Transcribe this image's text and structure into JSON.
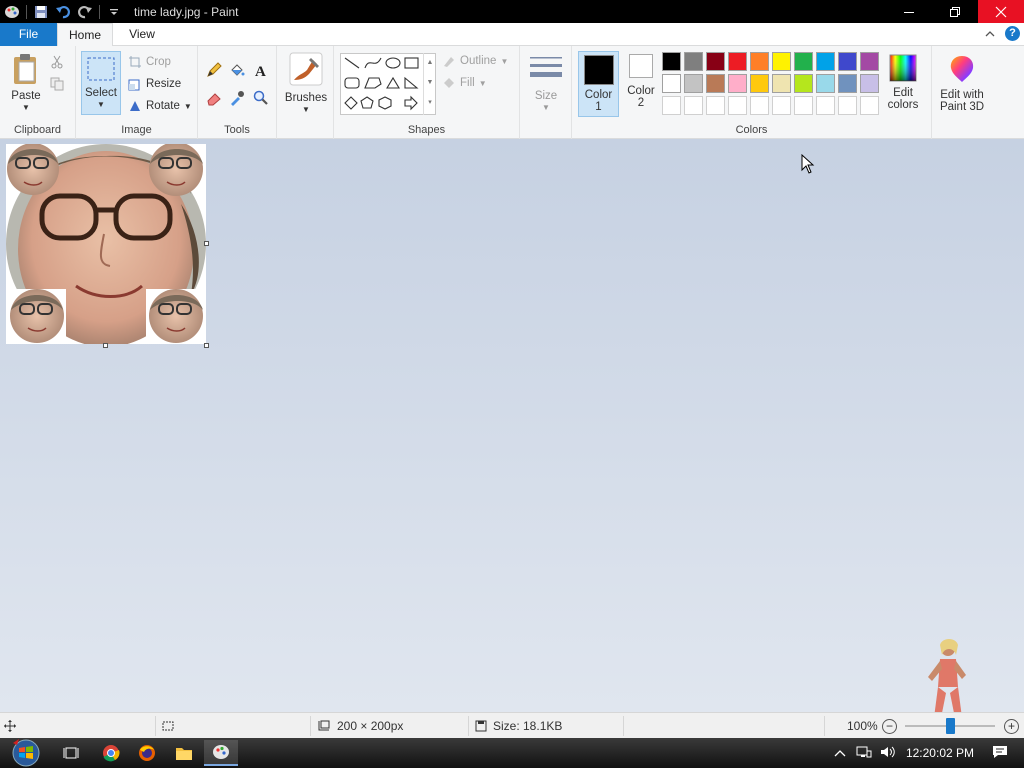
{
  "window": {
    "title": "time lady.jpg - Paint"
  },
  "tabs": {
    "file": "File",
    "home": "Home",
    "view": "View"
  },
  "ribbon": {
    "clipboard": {
      "label": "Clipboard",
      "paste": "Paste"
    },
    "image": {
      "label": "Image",
      "select": "Select",
      "crop": "Crop",
      "resize": "Resize",
      "rotate": "Rotate"
    },
    "tools": {
      "label": "Tools"
    },
    "brushes": {
      "label": "Brushes"
    },
    "shapes": {
      "label": "Shapes",
      "outline": "Outline",
      "fill": "Fill"
    },
    "size": {
      "label": "Size"
    },
    "colors": {
      "label": "Colors",
      "color1_line1": "Color",
      "color1_line2": "1",
      "color2_line1": "Color",
      "color2_line2": "2",
      "edit_line1": "Edit",
      "edit_line2": "colors",
      "paint3d_line1": "Edit with",
      "paint3d_line2": "Paint 3D",
      "color1": "#000000",
      "color2": "#ffffff",
      "palette_row1": [
        "#000000",
        "#7f7f7f",
        "#880015",
        "#ed1c24",
        "#ff7f27",
        "#fff200",
        "#22b14c",
        "#00a2e8",
        "#3f48cc",
        "#a349a4"
      ],
      "palette_row2": [
        "#ffffff",
        "#c3c3c3",
        "#b97a57",
        "#ffaec9",
        "#ffc90e",
        "#efe4b0",
        "#b5e61d",
        "#99d9ea",
        "#7092be",
        "#c8bfe7"
      ]
    }
  },
  "status": {
    "dimensions": "200 × 200px",
    "size": "Size: 18.1KB",
    "zoom": "100%"
  },
  "taskbar": {
    "time": "12:20:02 PM"
  }
}
